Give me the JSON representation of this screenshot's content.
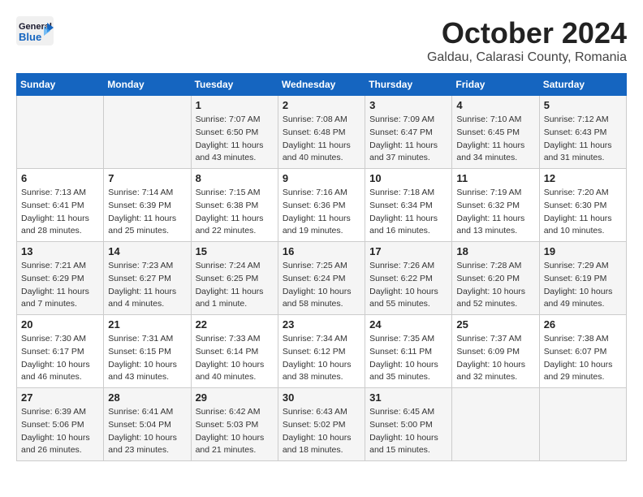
{
  "header": {
    "logo_line1": "General",
    "logo_line2": "Blue",
    "month": "October 2024",
    "location": "Galdau, Calarasi County, Romania"
  },
  "weekdays": [
    "Sunday",
    "Monday",
    "Tuesday",
    "Wednesday",
    "Thursday",
    "Friday",
    "Saturday"
  ],
  "weeks": [
    [
      {
        "day": "",
        "info": ""
      },
      {
        "day": "",
        "info": ""
      },
      {
        "day": "1",
        "info": "Sunrise: 7:07 AM\nSunset: 6:50 PM\nDaylight: 11 hours and 43 minutes."
      },
      {
        "day": "2",
        "info": "Sunrise: 7:08 AM\nSunset: 6:48 PM\nDaylight: 11 hours and 40 minutes."
      },
      {
        "day": "3",
        "info": "Sunrise: 7:09 AM\nSunset: 6:47 PM\nDaylight: 11 hours and 37 minutes."
      },
      {
        "day": "4",
        "info": "Sunrise: 7:10 AM\nSunset: 6:45 PM\nDaylight: 11 hours and 34 minutes."
      },
      {
        "day": "5",
        "info": "Sunrise: 7:12 AM\nSunset: 6:43 PM\nDaylight: 11 hours and 31 minutes."
      }
    ],
    [
      {
        "day": "6",
        "info": "Sunrise: 7:13 AM\nSunset: 6:41 PM\nDaylight: 11 hours and 28 minutes."
      },
      {
        "day": "7",
        "info": "Sunrise: 7:14 AM\nSunset: 6:39 PM\nDaylight: 11 hours and 25 minutes."
      },
      {
        "day": "8",
        "info": "Sunrise: 7:15 AM\nSunset: 6:38 PM\nDaylight: 11 hours and 22 minutes."
      },
      {
        "day": "9",
        "info": "Sunrise: 7:16 AM\nSunset: 6:36 PM\nDaylight: 11 hours and 19 minutes."
      },
      {
        "day": "10",
        "info": "Sunrise: 7:18 AM\nSunset: 6:34 PM\nDaylight: 11 hours and 16 minutes."
      },
      {
        "day": "11",
        "info": "Sunrise: 7:19 AM\nSunset: 6:32 PM\nDaylight: 11 hours and 13 minutes."
      },
      {
        "day": "12",
        "info": "Sunrise: 7:20 AM\nSunset: 6:30 PM\nDaylight: 11 hours and 10 minutes."
      }
    ],
    [
      {
        "day": "13",
        "info": "Sunrise: 7:21 AM\nSunset: 6:29 PM\nDaylight: 11 hours and 7 minutes."
      },
      {
        "day": "14",
        "info": "Sunrise: 7:23 AM\nSunset: 6:27 PM\nDaylight: 11 hours and 4 minutes."
      },
      {
        "day": "15",
        "info": "Sunrise: 7:24 AM\nSunset: 6:25 PM\nDaylight: 11 hours and 1 minute."
      },
      {
        "day": "16",
        "info": "Sunrise: 7:25 AM\nSunset: 6:24 PM\nDaylight: 10 hours and 58 minutes."
      },
      {
        "day": "17",
        "info": "Sunrise: 7:26 AM\nSunset: 6:22 PM\nDaylight: 10 hours and 55 minutes."
      },
      {
        "day": "18",
        "info": "Sunrise: 7:28 AM\nSunset: 6:20 PM\nDaylight: 10 hours and 52 minutes."
      },
      {
        "day": "19",
        "info": "Sunrise: 7:29 AM\nSunset: 6:19 PM\nDaylight: 10 hours and 49 minutes."
      }
    ],
    [
      {
        "day": "20",
        "info": "Sunrise: 7:30 AM\nSunset: 6:17 PM\nDaylight: 10 hours and 46 minutes."
      },
      {
        "day": "21",
        "info": "Sunrise: 7:31 AM\nSunset: 6:15 PM\nDaylight: 10 hours and 43 minutes."
      },
      {
        "day": "22",
        "info": "Sunrise: 7:33 AM\nSunset: 6:14 PM\nDaylight: 10 hours and 40 minutes."
      },
      {
        "day": "23",
        "info": "Sunrise: 7:34 AM\nSunset: 6:12 PM\nDaylight: 10 hours and 38 minutes."
      },
      {
        "day": "24",
        "info": "Sunrise: 7:35 AM\nSunset: 6:11 PM\nDaylight: 10 hours and 35 minutes."
      },
      {
        "day": "25",
        "info": "Sunrise: 7:37 AM\nSunset: 6:09 PM\nDaylight: 10 hours and 32 minutes."
      },
      {
        "day": "26",
        "info": "Sunrise: 7:38 AM\nSunset: 6:07 PM\nDaylight: 10 hours and 29 minutes."
      }
    ],
    [
      {
        "day": "27",
        "info": "Sunrise: 6:39 AM\nSunset: 5:06 PM\nDaylight: 10 hours and 26 minutes."
      },
      {
        "day": "28",
        "info": "Sunrise: 6:41 AM\nSunset: 5:04 PM\nDaylight: 10 hours and 23 minutes."
      },
      {
        "day": "29",
        "info": "Sunrise: 6:42 AM\nSunset: 5:03 PM\nDaylight: 10 hours and 21 minutes."
      },
      {
        "day": "30",
        "info": "Sunrise: 6:43 AM\nSunset: 5:02 PM\nDaylight: 10 hours and 18 minutes."
      },
      {
        "day": "31",
        "info": "Sunrise: 6:45 AM\nSunset: 5:00 PM\nDaylight: 10 hours and 15 minutes."
      },
      {
        "day": "",
        "info": ""
      },
      {
        "day": "",
        "info": ""
      }
    ]
  ]
}
